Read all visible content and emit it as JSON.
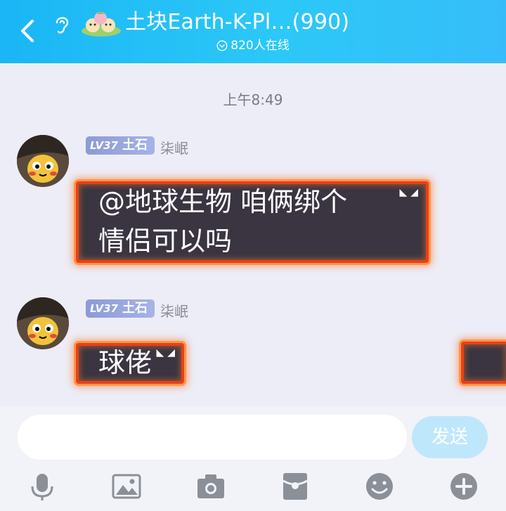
{
  "header": {
    "title": "土块Earth-K-Pl…(990)",
    "online": "820人在线"
  },
  "chat": {
    "timestamp": "上午8:49",
    "messages": [
      {
        "level": "LV37",
        "level_title": "土石",
        "nickname": "柒岷",
        "text_line1": "@地球生物 咱俩绑个",
        "text_line2": "情侣可以吗"
      },
      {
        "level": "LV37",
        "level_title": "土石",
        "nickname": "柒岷",
        "text_line1": "球佬"
      }
    ]
  },
  "input": {
    "placeholder": "",
    "send_label": "发送"
  },
  "toolbar": [
    "mic-icon",
    "image-icon",
    "camera-icon",
    "red-packet-icon",
    "emoji-icon",
    "plus-icon"
  ],
  "colors": {
    "header": "#1ab6f5",
    "background": "#ecedf6",
    "bubble": "#3a3541",
    "bubble_fire": "#e8401a",
    "send_button": "#bfe7fb",
    "level_badge": "#8c9ad6"
  }
}
